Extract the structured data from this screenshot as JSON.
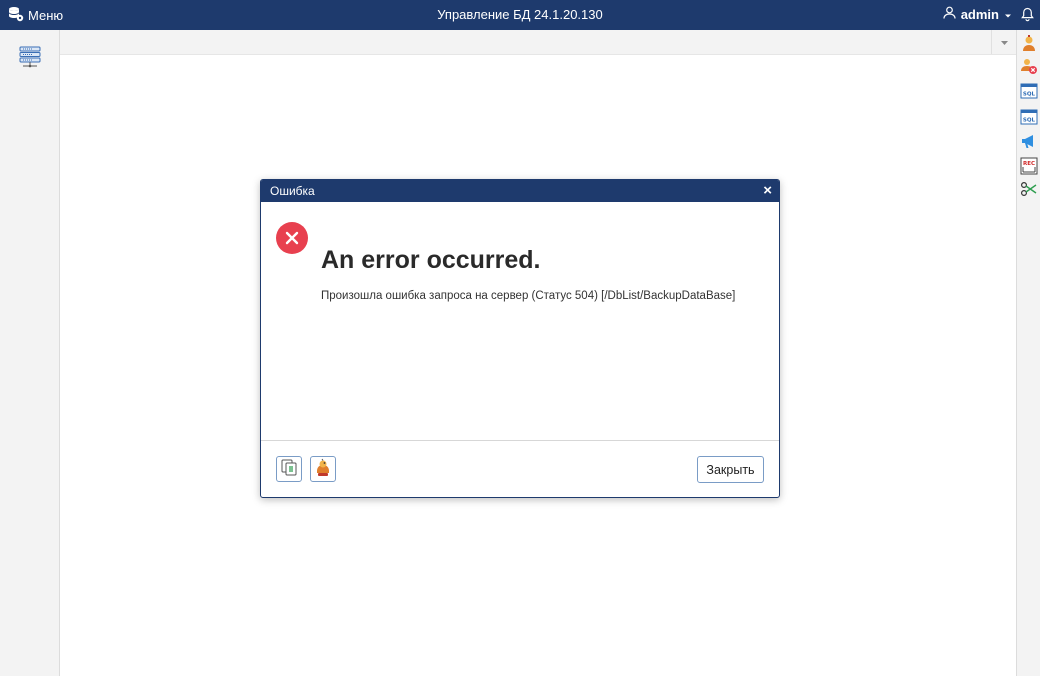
{
  "topbar": {
    "menu_label": "Меню",
    "app_title": "Управление БД 24.1.20.130",
    "username": "admin"
  },
  "sidebar_right": {
    "items": [
      "user-assistant-icon",
      "user-remove-icon",
      "sql-icon",
      "sql-icon",
      "megaphone-icon",
      "rec-icon",
      "scissors-icon"
    ],
    "sql_label": "SQL",
    "rec_label": "REC"
  },
  "dialog": {
    "title": "Ошибка",
    "heading": "An error occurred.",
    "message": "Произошла ошибка запроса на сервер (Статус 504) [/DbList/BackupDataBase]",
    "close_button": "Закрыть"
  },
  "colors": {
    "brand_navy": "#1e3a6d",
    "error_red": "#e8404f",
    "button_border": "#7a9cc6"
  }
}
